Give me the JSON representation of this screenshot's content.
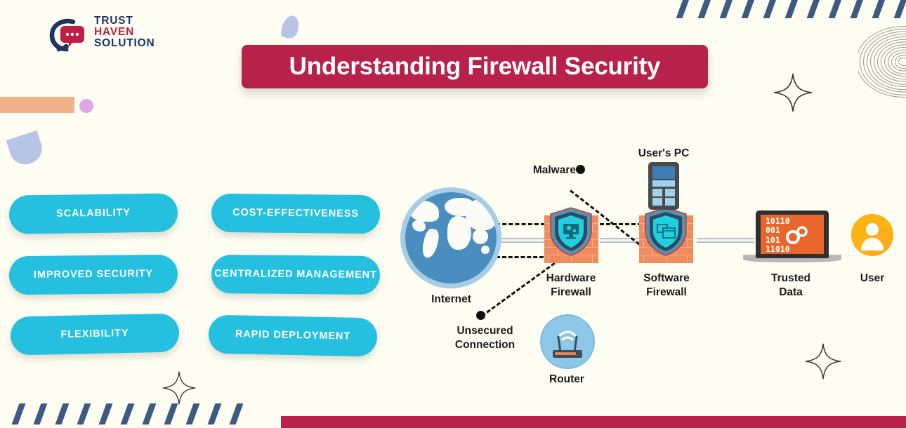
{
  "brand": {
    "logo_icon": "headset-chat-bubble-logo",
    "line1": "TRUST",
    "line2": "HAVEN",
    "line3": "SOLUTION",
    "navy": "#1c3564",
    "crimson": "#bf1e45"
  },
  "header": {
    "title": "Understanding Firewall Security",
    "banner_color": "#b7214a",
    "title_color": "#ffffff"
  },
  "benefits": {
    "accent_color": "#25bfe0",
    "items": [
      {
        "label": "SCALABILITY"
      },
      {
        "label": "COST-EFFECTIVENESS"
      },
      {
        "label": "IMPROVED SECURITY"
      },
      {
        "label": "CENTRALIZED\nMANAGEMENT"
      },
      {
        "label": "FLEXIBILITY"
      },
      {
        "label": "RAPID DEPLOYMENT"
      }
    ]
  },
  "diagram": {
    "nodes": {
      "internet": "Internet",
      "hardware_firewall": "Hardware\nFirewall",
      "software_firewall": "Software\nFirewall",
      "users_pc": "User's PC",
      "trusted_data": "Trusted\nData",
      "user": "User",
      "router": "Router",
      "malware": "Malware",
      "unsecured_connection": "Unsecured\nConnection"
    },
    "trusted_data_code": "10110\n001\n101\n11010",
    "colors": {
      "globe": "#4a8ec0",
      "globe_ring": "#a7cde6",
      "brick": "#f08b5d",
      "shield": "#2fd8e0",
      "screen": "#e8662c",
      "user_avatar": "#fcb415",
      "router_circle": "#8dc8e8"
    }
  },
  "decor": {
    "stripe_color": "#3d5a80",
    "peach_bar": "#f0b289",
    "lilac_dot": "#dba8e8",
    "periwinkle": "#b6c4e6",
    "arc_color": "#9b9b93",
    "bottom_bar_color": "#b7214a",
    "background": "#fdfdf1"
  }
}
